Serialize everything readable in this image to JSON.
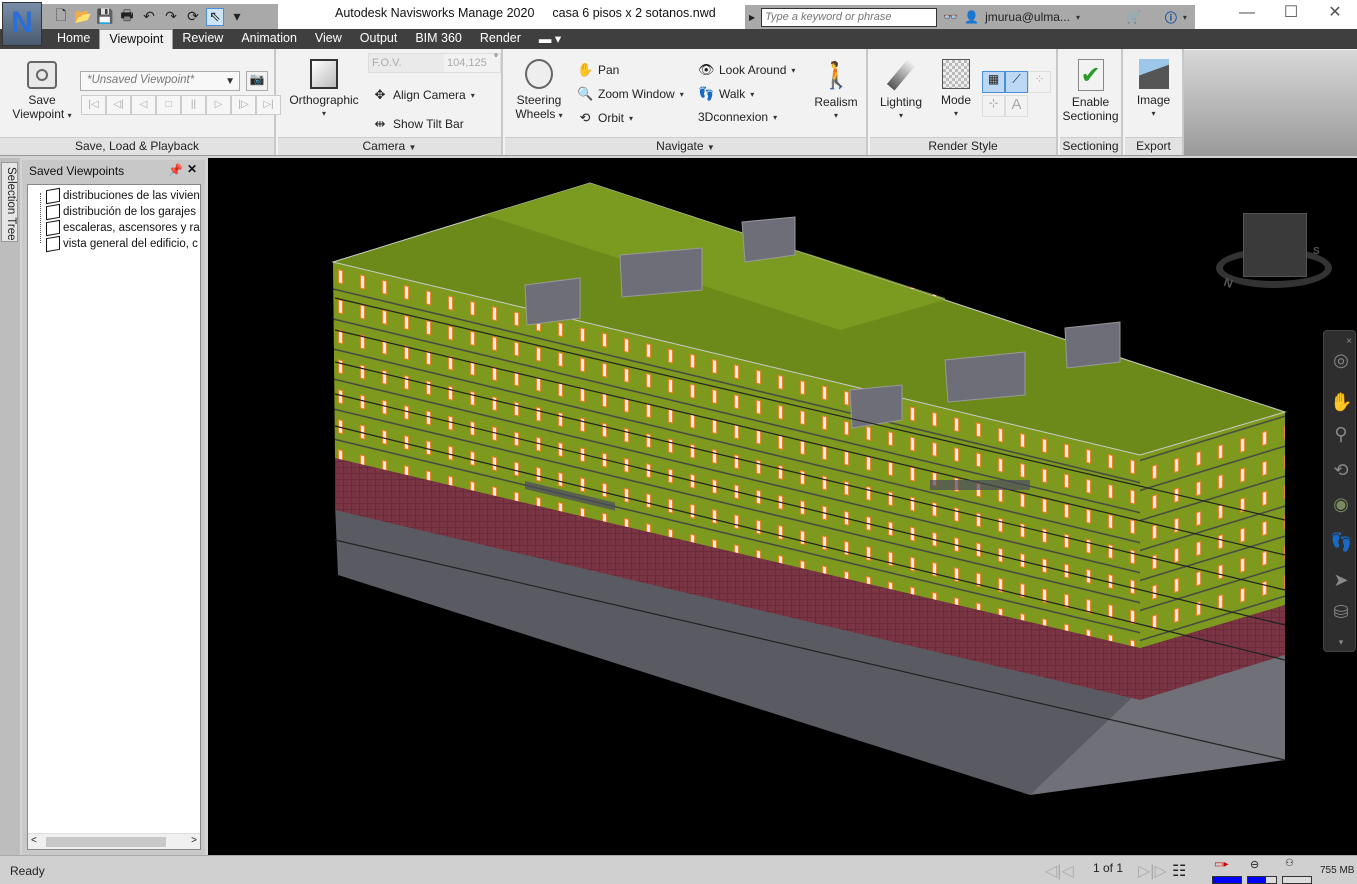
{
  "app": {
    "logo": "N",
    "title": "Autodesk Navisworks Manage 2020",
    "file": "casa 6 pisos x 2 sotanos.nwd"
  },
  "qat": {
    "icons": [
      "new-icon",
      "open-icon",
      "save-icon",
      "print-icon",
      "undo-icon",
      "redo-icon",
      "refresh-icon",
      "select-icon"
    ]
  },
  "infocenter": {
    "search_placeholder": "Type a keyword or phrase",
    "user": "jmurua@ulma...",
    "icons": [
      "binoculars-icon",
      "user-icon",
      "cart-icon",
      "help-icon"
    ]
  },
  "tabs": [
    {
      "label": "Home"
    },
    {
      "label": "Viewpoint",
      "active": true
    },
    {
      "label": "Review"
    },
    {
      "label": "Animation"
    },
    {
      "label": "View"
    },
    {
      "label": "Output"
    },
    {
      "label": "BIM 360"
    },
    {
      "label": "Render"
    }
  ],
  "ribbon": {
    "save": {
      "save_viewpoint": "Save",
      "save_viewpoint2": "Viewpoint",
      "combo": "*Unsaved Viewpoint*",
      "label": "Save, Load & Playback"
    },
    "camera": {
      "orthographic": "Orthographic",
      "fov_label": "F.O.V.",
      "fov_value": "104,125",
      "fov_unit": "°",
      "align": "Align Camera",
      "tilt": "Show Tilt Bar",
      "label": "Camera"
    },
    "navigate": {
      "steering": "Steering",
      "steering2": "Wheels",
      "pan": "Pan",
      "zoom": "Zoom Window",
      "orbit": "Orbit",
      "look": "Look Around",
      "walk": "Walk",
      "conn": "3Dconnexion",
      "realism": "Realism",
      "label": "Navigate"
    },
    "render": {
      "lighting": "Lighting",
      "mode": "Mode",
      "label": "Render Style"
    },
    "sectioning": {
      "enable": "Enable",
      "enable2": "Sectioning",
      "label": "Sectioning"
    },
    "export": {
      "image": "Image",
      "label": "Export"
    }
  },
  "side": {
    "tab": "Selection Tree",
    "panel_title": "Saved Viewpoints",
    "items": [
      "distribuciones de las viviendas",
      "distribución de los garajes",
      "escaleras, ascensores y rampas",
      "vista general del edificio, c"
    ]
  },
  "viewcube": {
    "labels": [
      "N",
      "S",
      "E",
      "W"
    ]
  },
  "status": {
    "text": "Ready",
    "page": "1 of 1",
    "memory": "755 MB",
    "progress": {
      "pencil": 100,
      "disk": 65,
      "network": 0
    },
    "accent": "#0000ff"
  }
}
